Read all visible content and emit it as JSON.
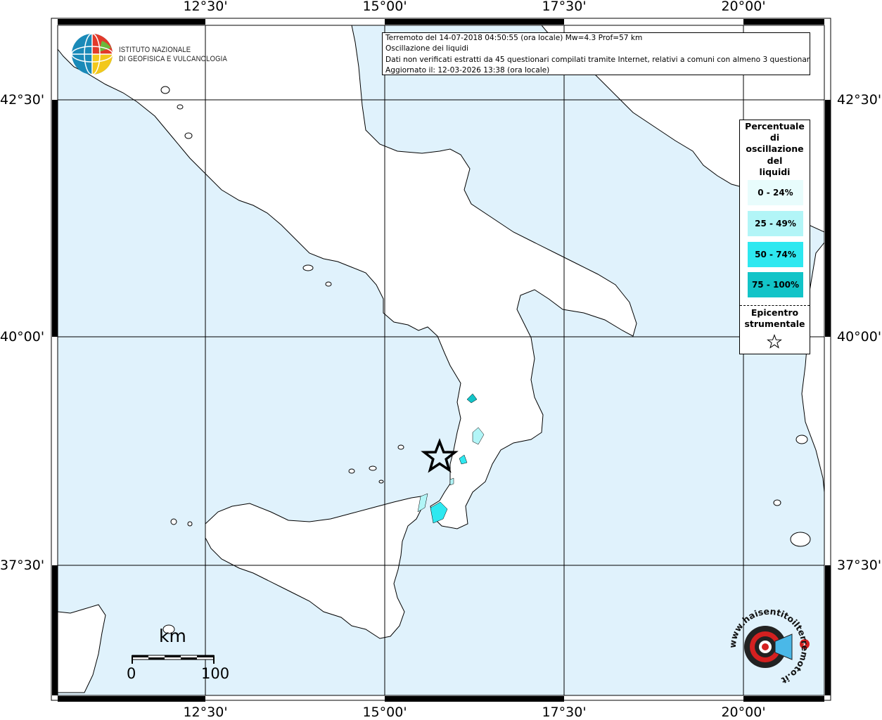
{
  "map": {
    "ticks_top": [
      "12°30'",
      "15°00'",
      "17°30'",
      "20°00'"
    ],
    "ticks_bottom": [
      "12°30'",
      "15°00'",
      "17°30'",
      "20°00'"
    ],
    "ticks_left": [
      "42°30'",
      "40°00'",
      "37°30'"
    ],
    "ticks_right": [
      "42°30'",
      "40°00'",
      "37°30'"
    ],
    "sea_color": "#e0f2fc",
    "land_color": "#ffffff"
  },
  "info": {
    "line1": "Terremoto del 14-07-2018 04:50:55 (ora locale) Mw=4.3 Prof=57 km",
    "line2": "Oscillazione dei liquidi",
    "line3": "Dati non verificati estratti da 45 questionari compilati tramite Internet, relativi a comuni con almeno 3 questionari.",
    "line4": "Aggiornato il: 12-03-2026 13:38 (ora locale)"
  },
  "legend": {
    "title_lines": [
      "Percentuale",
      "di",
      "oscillazione",
      "del",
      "liquidi"
    ],
    "classes": [
      {
        "label": "0 - 24%",
        "color": "#e8fcfc"
      },
      {
        "label": "25 - 49%",
        "color": "#b2f5f7"
      },
      {
        "label": "50 - 74%",
        "color": "#2ee8f0"
      },
      {
        "label": "75 - 100%",
        "color": "#12c4c8"
      }
    ],
    "epicenter_lines": [
      "Epicentro",
      "strumentale"
    ],
    "epicenter_icon": "star-icon"
  },
  "logo": {
    "line1": "ISTITUTO NAZIONALE",
    "line2": "DI GEOFISICA E VULCANOLOGIA"
  },
  "scale": {
    "title": "km",
    "min": "0",
    "max": "100"
  },
  "hst": {
    "text": "www.haisentitoilterremoto.it",
    "icon": "megaphone-icon"
  }
}
